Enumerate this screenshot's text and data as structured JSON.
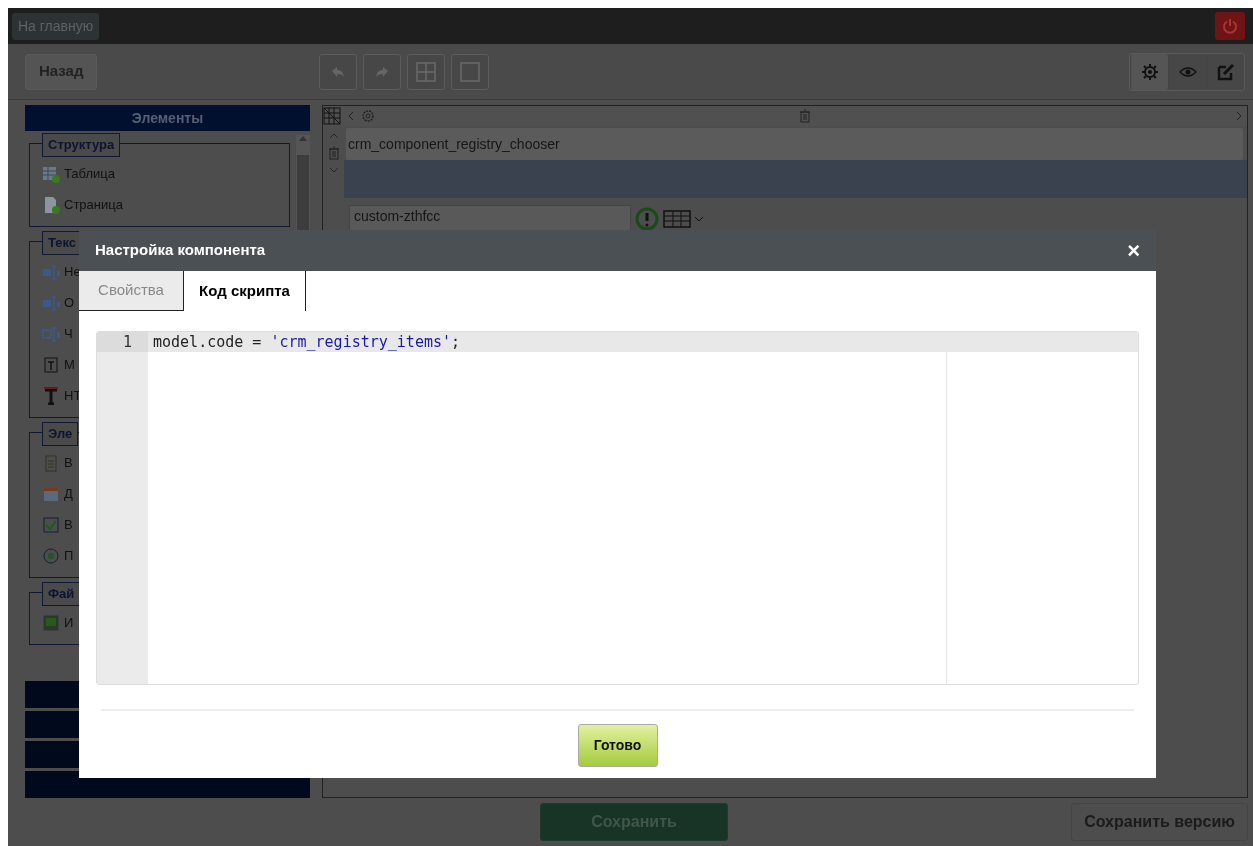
{
  "top_bar": {
    "home_button": "На главную"
  },
  "toolbar": {
    "back_button": "Назад"
  },
  "sidebar": {
    "title": "Элементы",
    "groups": [
      {
        "legend": "Структура",
        "items": [
          "Таблица",
          "Страница"
        ]
      },
      {
        "legend": "Текс",
        "items": [
          "Не",
          "О",
          "Ч",
          "М",
          "НТ"
        ]
      },
      {
        "legend": "Эле",
        "items": [
          "В",
          "Д",
          "В",
          "П"
        ]
      },
      {
        "legend": "Фай",
        "items": [
          "И"
        ]
      }
    ]
  },
  "canvas": {
    "component_name": "crm_component_registry_chooser",
    "css_class_field": "custom-zthfcc"
  },
  "footer": {
    "save_button": "Сохранить",
    "save_version_button": "Сохранить версию"
  },
  "modal": {
    "title": "Настройка компонента",
    "close": "×",
    "tabs": [
      {
        "label": "Свойства",
        "selected": false
      },
      {
        "label": "Код скрипта",
        "selected": true
      }
    ],
    "editor": {
      "lines": [
        {
          "number": "1",
          "active": true,
          "tokens": [
            {
              "kind": "plain",
              "text": "model.code = "
            },
            {
              "kind": "string",
              "text": "'crm_registry_items'"
            },
            {
              "kind": "plain",
              "text": ";"
            }
          ]
        }
      ]
    },
    "done_button": "Готово"
  }
}
